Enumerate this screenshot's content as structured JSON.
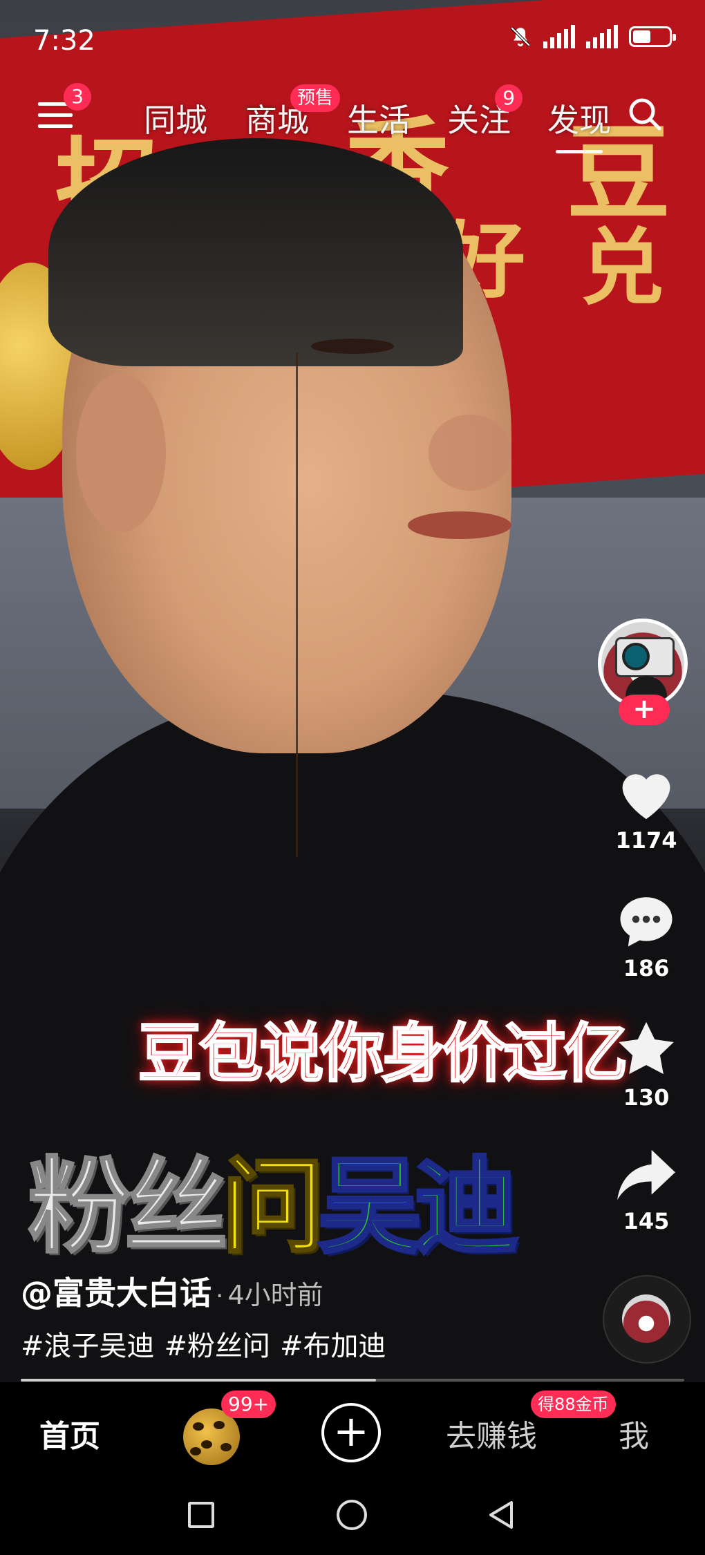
{
  "status_bar": {
    "time": "7:32"
  },
  "top_nav": {
    "menu_badge": "3",
    "tabs": [
      {
        "label": "同城",
        "badge": ""
      },
      {
        "label": "商城",
        "badge": "预售"
      },
      {
        "label": "生活",
        "badge": ""
      },
      {
        "label": "关注",
        "badge": "9"
      },
      {
        "label": "发现",
        "badge": "",
        "active": true
      }
    ]
  },
  "video": {
    "caption_top": "豆包说你身价过亿",
    "caption_main": {
      "part1": "粉丝",
      "part2": "问",
      "part3": "吴迪"
    }
  },
  "actions": {
    "follow_symbol": "+",
    "likes": "1174",
    "comments": "186",
    "favorites": "130",
    "shares": "145"
  },
  "post": {
    "author": "@富贵大白话",
    "separator": "·",
    "time_ago": "4小时前",
    "hashtags": [
      "#浪子吴迪",
      "#粉丝问",
      "#布加迪"
    ],
    "progress": 0.535
  },
  "bottom_nav": {
    "home": "首页",
    "friends_badge": "99+",
    "add_symbol": "+",
    "earn": "去赚钱",
    "earn_badge": "得88金币",
    "me": "我"
  },
  "colors": {
    "accent_badge": "#ff2c55",
    "follow": "#fe2c55"
  }
}
